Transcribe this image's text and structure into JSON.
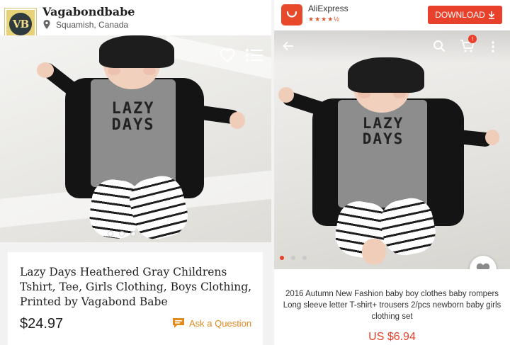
{
  "left": {
    "shop_name": "Vagabondbabe",
    "avatar_text": "VB",
    "location": "Squamish, Canada",
    "product_title": "Lazy Days Heathered Gray Childrens Tshirt, Tee,  Girls Clothing, Boys Clothing, Printed by Vagabond Babe",
    "price": "$24.97",
    "ask_label": "Ask a Question",
    "shirt_print_line1": "LAZY",
    "shirt_print_line2": "DAYS",
    "image_dots": 3,
    "active_dot": 0
  },
  "right": {
    "app_name": "AliExpress",
    "app_rating_stars": "★★★★½",
    "download_label": "DOWNLOAD",
    "cart_badge": "!",
    "product_desc": "2016 Autumn New Fashion baby boy clothes baby rompers Long sleeve letter T-shirt+ trousers 2/pcs newborn baby girls clothing set",
    "price": "US $6.94",
    "shirt_print_line1": "LAZY",
    "shirt_print_line2": "DAYS",
    "image_dots": 3,
    "active_dot": 0
  },
  "colors": {
    "etsy_orange": "#e08a1e",
    "ali_red": "#e8402a"
  },
  "icons": [
    "location-pin-icon",
    "heart-icon",
    "list-icon",
    "ask-question-icon",
    "back-arrow-icon",
    "search-icon",
    "cart-icon",
    "more-vert-icon",
    "favorite-heart-icon",
    "download-arrow-icon"
  ]
}
